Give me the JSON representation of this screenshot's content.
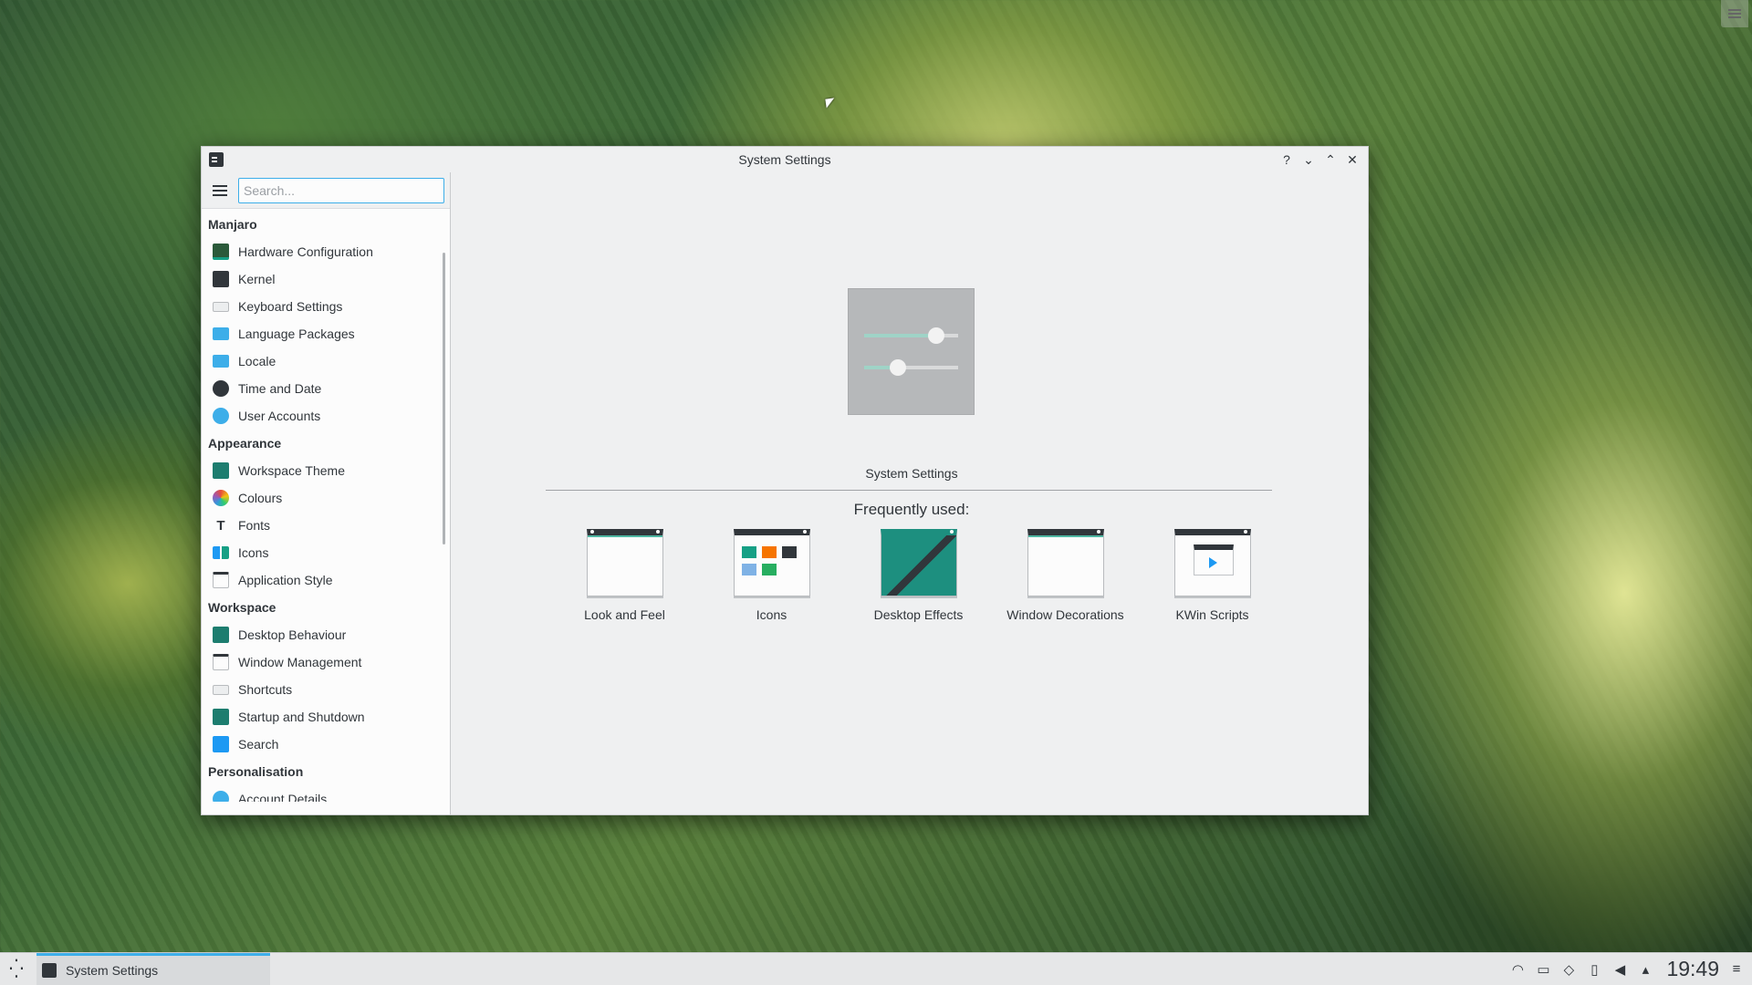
{
  "window": {
    "title": "System Settings",
    "help_glyph": "?",
    "minimize_glyph": "⌄",
    "maximize_glyph": "⌃",
    "close_glyph": "✕"
  },
  "search": {
    "placeholder": "Search..."
  },
  "sidebar": {
    "groups": [
      {
        "header": "Manjaro",
        "items": [
          {
            "label": "Hardware Configuration",
            "icon": "hardware-icon"
          },
          {
            "label": "Kernel",
            "icon": "kernel-icon"
          },
          {
            "label": "Keyboard Settings",
            "icon": "keyboard-icon"
          },
          {
            "label": "Language Packages",
            "icon": "language-icon"
          },
          {
            "label": "Locale",
            "icon": "locale-icon"
          },
          {
            "label": "Time and Date",
            "icon": "clock-icon"
          },
          {
            "label": "User Accounts",
            "icon": "user-icon"
          }
        ]
      },
      {
        "header": "Appearance",
        "items": [
          {
            "label": "Workspace Theme",
            "icon": "theme-icon"
          },
          {
            "label": "Colours",
            "icon": "colours-icon"
          },
          {
            "label": "Fonts",
            "icon": "fonts-icon"
          },
          {
            "label": "Icons",
            "icon": "icons-icon"
          },
          {
            "label": "Application Style",
            "icon": "app-style-icon"
          }
        ]
      },
      {
        "header": "Workspace",
        "items": [
          {
            "label": "Desktop Behaviour",
            "icon": "desktop-behaviour-icon"
          },
          {
            "label": "Window Management",
            "icon": "window-management-icon"
          },
          {
            "label": "Shortcuts",
            "icon": "shortcuts-icon"
          },
          {
            "label": "Startup and Shutdown",
            "icon": "startup-icon"
          },
          {
            "label": "Search",
            "icon": "search-icon"
          }
        ]
      },
      {
        "header": "Personalisation",
        "items": [
          {
            "label": "Account Details",
            "icon": "account-icon"
          }
        ]
      }
    ]
  },
  "main": {
    "hero_label": "System Settings",
    "hero_icon": "settings-sliders-icon",
    "frequently_used_title": "Frequently used:",
    "frequently_used": [
      {
        "label": "Look and Feel",
        "icon": "look-and-feel-icon"
      },
      {
        "label": "Icons",
        "icon": "icons-icon"
      },
      {
        "label": "Desktop Effects",
        "icon": "desktop-effects-icon"
      },
      {
        "label": "Window Decorations",
        "icon": "window-decorations-icon"
      },
      {
        "label": "KWin Scripts",
        "icon": "kwin-scripts-icon"
      }
    ]
  },
  "taskbar": {
    "task_label": "System Settings",
    "clock": "19:49"
  },
  "colors": {
    "accent": "#3daee9",
    "teal": "#16a085",
    "window_bg": "#eff0f1",
    "text": "#31363b"
  }
}
